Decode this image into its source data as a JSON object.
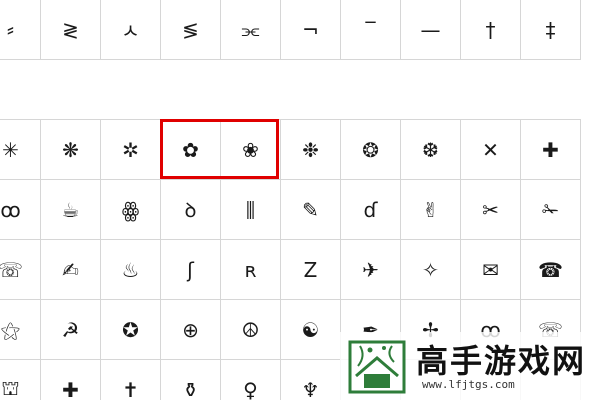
{
  "symbol_table": {
    "top_row": [
      "⸗",
      "≷",
      "ㅅ",
      "≶",
      "⫘",
      "¬",
      "‾",
      "—",
      "†",
      "‡"
    ],
    "rows": [
      [
        "✳",
        "❋",
        "✲",
        "✿",
        "❀",
        "❉",
        "❂",
        "❆",
        "✕",
        "✚"
      ],
      [
        "ꝏ",
        "☕",
        "ꙮ",
        "ꝺ",
        "⫼",
        "✎",
        "ɗ",
        "✌",
        "✂",
        "✁"
      ],
      [
        "☏",
        "✍",
        "♨",
        "ʃ",
        "ʀ",
        "Z",
        "✈",
        "✧",
        "✉",
        "☎"
      ],
      [
        "⚝",
        "☭",
        "✪",
        "⊕",
        "☮",
        "☯",
        "✒",
        "✢",
        "ꝏ",
        "☏"
      ],
      [
        "⛫",
        "✚",
        "✝",
        "⚱",
        "♀",
        "♆",
        "",
        "",
        "",
        ""
      ]
    ],
    "highlighted_cells": [
      "✿",
      "❀"
    ],
    "highlight_color": "#e00000",
    "grid_line_color": "#d6d6d6"
  },
  "watermark": {
    "title": "高手游戏网",
    "url": "www.lfjtgs.com",
    "logo_color": "#2e7d3a"
  }
}
